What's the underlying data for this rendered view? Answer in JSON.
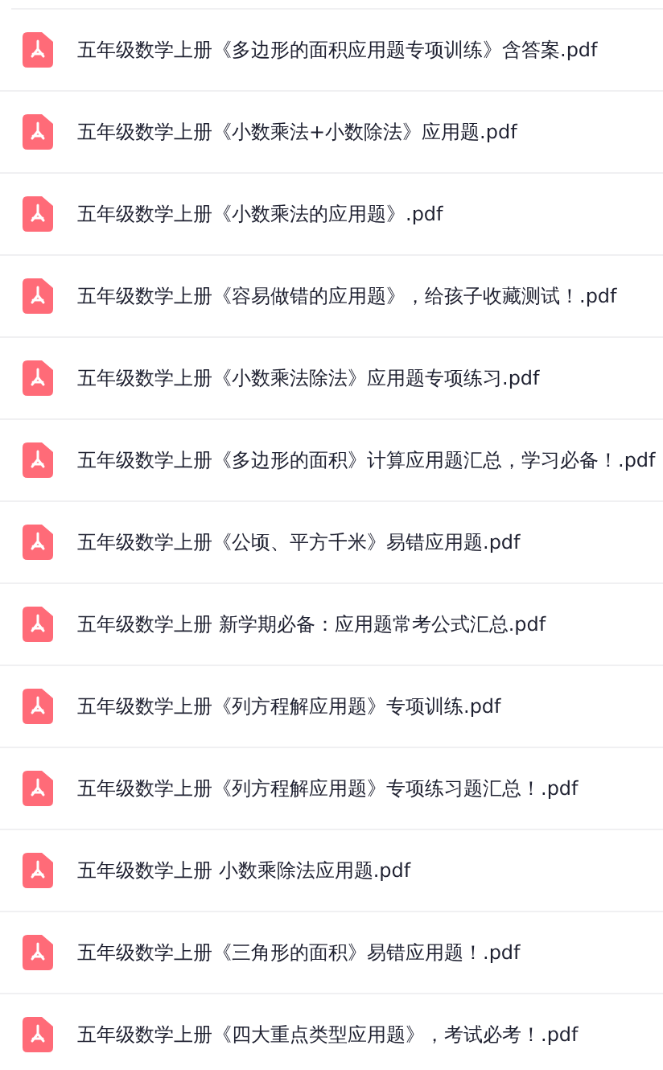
{
  "files": [
    {
      "kind": "pdf",
      "name": "五年级数学上册《多边形的面积应用题专项训练》含答案.pdf"
    },
    {
      "kind": "pdf",
      "name": "五年级数学上册《小数乘法+小数除法》应用题.pdf"
    },
    {
      "kind": "pdf",
      "name": "五年级数学上册《小数乘法的应用题》.pdf"
    },
    {
      "kind": "pdf",
      "name": "五年级数学上册《容易做错的应用题》，给孩子收藏测试！.pdf"
    },
    {
      "kind": "pdf",
      "name": "五年级数学上册《小数乘法除法》应用题专项练习.pdf"
    },
    {
      "kind": "pdf",
      "name": "五年级数学上册《多边形的面积》计算应用题汇总，学习必备！.pdf"
    },
    {
      "kind": "pdf",
      "name": "五年级数学上册《公顷、平方千米》易错应用题.pdf"
    },
    {
      "kind": "pdf",
      "name": "五年级数学上册 新学期必备：应用题常考公式汇总.pdf"
    },
    {
      "kind": "pdf",
      "name": "五年级数学上册《列方程解应用题》专项训练.pdf"
    },
    {
      "kind": "pdf",
      "name": "五年级数学上册《列方程解应用题》专项练习题汇总！.pdf"
    },
    {
      "kind": "pdf",
      "name": "五年级数学上册 小数乘除法应用题.pdf"
    },
    {
      "kind": "pdf",
      "name": "五年级数学上册《三角形的面积》易错应用题！.pdf"
    },
    {
      "kind": "pdf",
      "name": "五年级数学上册《四大重点类型应用题》，考试必考！.pdf"
    }
  ]
}
